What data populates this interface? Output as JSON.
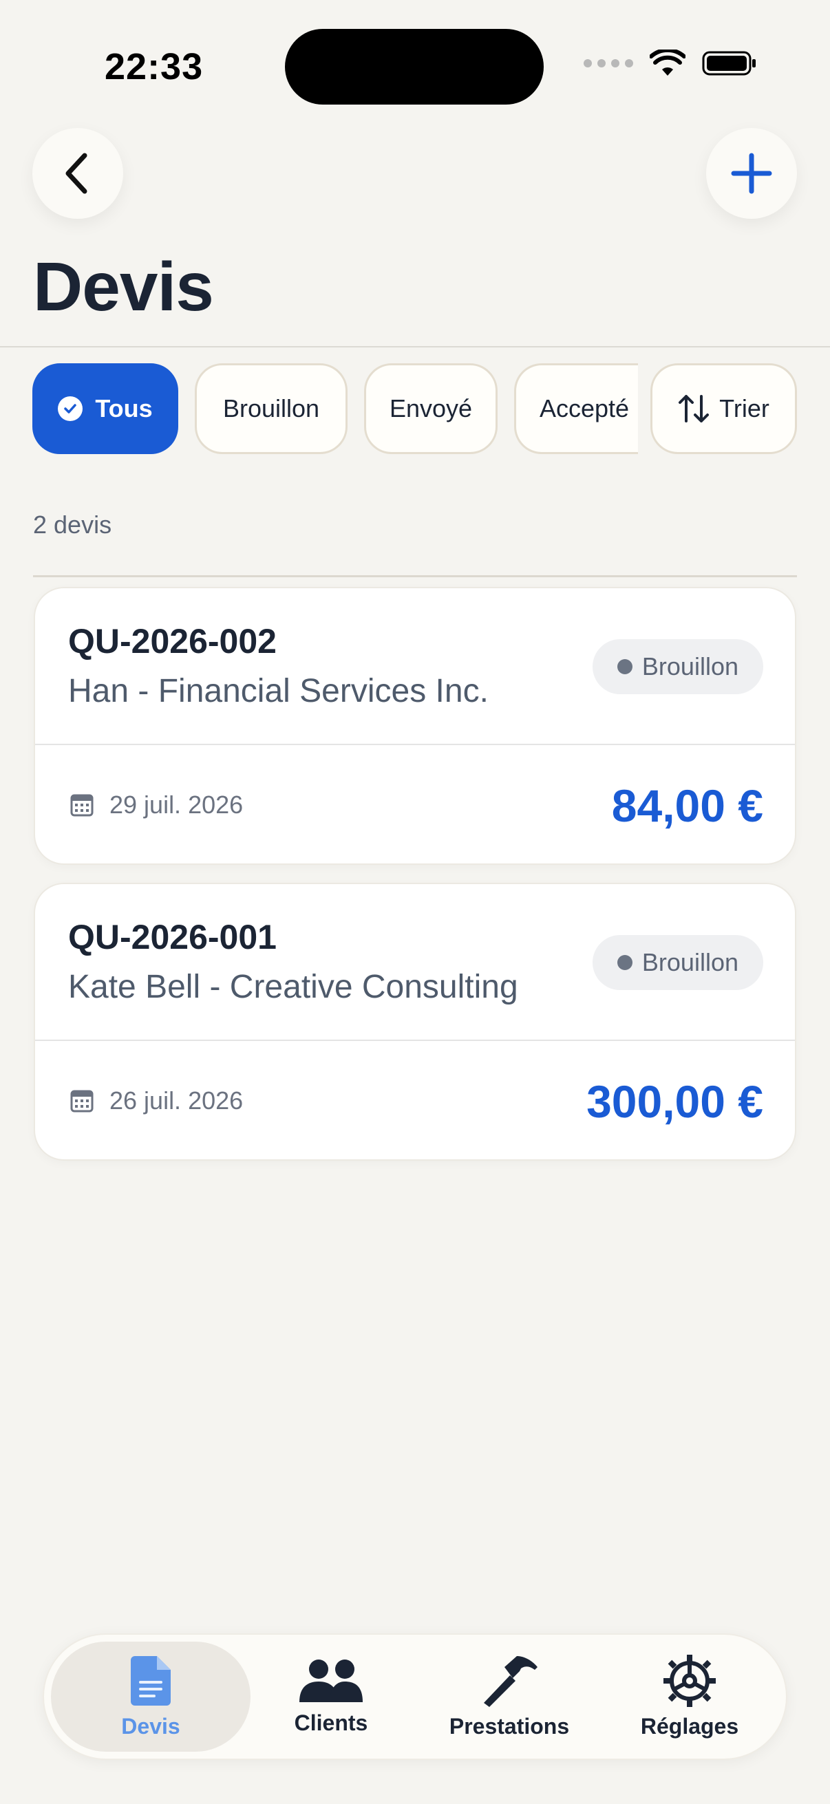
{
  "status_bar": {
    "time": "22:33"
  },
  "header": {
    "title": "Devis"
  },
  "filters": [
    {
      "label": "Tous",
      "active": true
    },
    {
      "label": "Brouillon",
      "active": false
    },
    {
      "label": "Envoyé",
      "active": false
    },
    {
      "label": "Accepté",
      "active": false
    }
  ],
  "sort": {
    "label": "Trier"
  },
  "list": {
    "count_label": "2 devis",
    "items": [
      {
        "ref": "QU-2026-002",
        "client": "Han - Financial Services Inc.",
        "status": "Brouillon",
        "date": "29 juil. 2026",
        "amount": "84,00 €"
      },
      {
        "ref": "QU-2026-001",
        "client": "Kate Bell - Creative Consulting",
        "status": "Brouillon",
        "date": "26 juil. 2026",
        "amount": "300,00 €"
      }
    ]
  },
  "tabbar": {
    "items": [
      {
        "label": "Devis",
        "icon": "document-icon",
        "active": true
      },
      {
        "label": "Clients",
        "icon": "people-icon",
        "active": false
      },
      {
        "label": "Prestations",
        "icon": "hammer-icon",
        "active": false
      },
      {
        "label": "Réglages",
        "icon": "gear-icon",
        "active": false
      }
    ]
  },
  "colors": {
    "accent": "#1a5bd4",
    "background": "#f5f4f0",
    "status_draft": "#6b7483"
  }
}
